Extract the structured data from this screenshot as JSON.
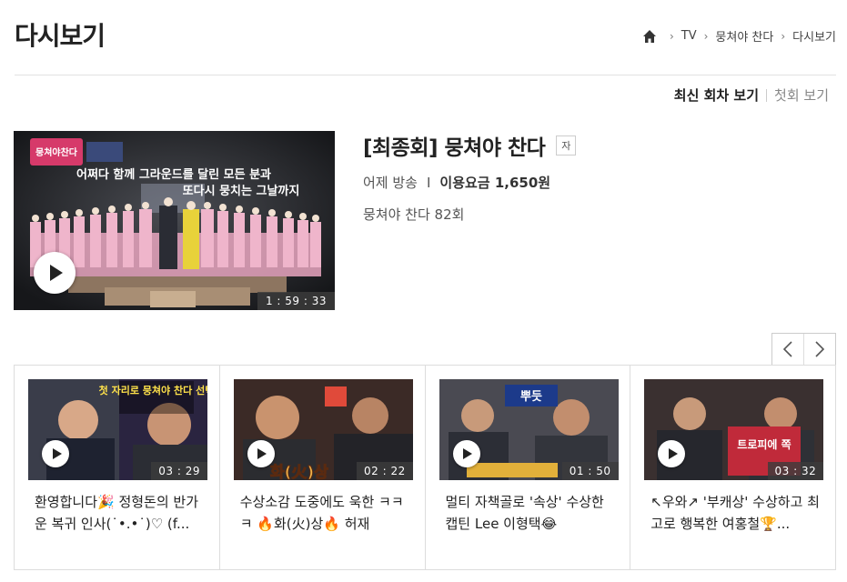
{
  "page": {
    "title": "다시보기"
  },
  "breadcrumb": {
    "home_icon": "home-icon",
    "items": [
      "TV",
      "뭉쳐야 찬다",
      "다시보기"
    ]
  },
  "view_toggle": {
    "latest": "최신 회차 보기",
    "first": "첫회 보기"
  },
  "featured": {
    "title": "[최종회] 뭉쳐야 찬다",
    "badge": "자",
    "aired": "어제 방송",
    "price_label": "이용요금 1,650원",
    "episode": "뭉쳐야 찬다 82회",
    "duration": "1 : 59 : 33",
    "thumb_caption": [
      "어쩌다 함께 그라운드를 달린 모든 분과",
      "또다시 뭉치는 그날까지"
    ],
    "logo_text": "뭉쳐야찬다"
  },
  "carousel": {
    "prev_label": "‹",
    "next_label": "›"
  },
  "clips": [
    {
      "title": "환영합니다🎉 정형돈의 반가운 복귀 인사(˙•.•˙)♡ (f...",
      "duration": "03 : 29",
      "overlay": "첫 자리로 뭉쳐야 찬다 선택"
    },
    {
      "title": "수상소감 도중에도 욱한 ㅋㅋㅋ 🔥화(火)상🔥 허재",
      "duration": "02 : 22",
      "overlay": "화(火)상"
    },
    {
      "title": "멀티 자책골로 '속상' 수상한 캡틴 Lee 이형택😂",
      "duration": "01 : 50",
      "overlay": "뿌듯"
    },
    {
      "title": "↖우와↗ '부캐상' 수상하고 최고로 행복한 여홍철🏆...",
      "duration": "03 : 32",
      "overlay": "트로피에 쪽"
    }
  ]
}
